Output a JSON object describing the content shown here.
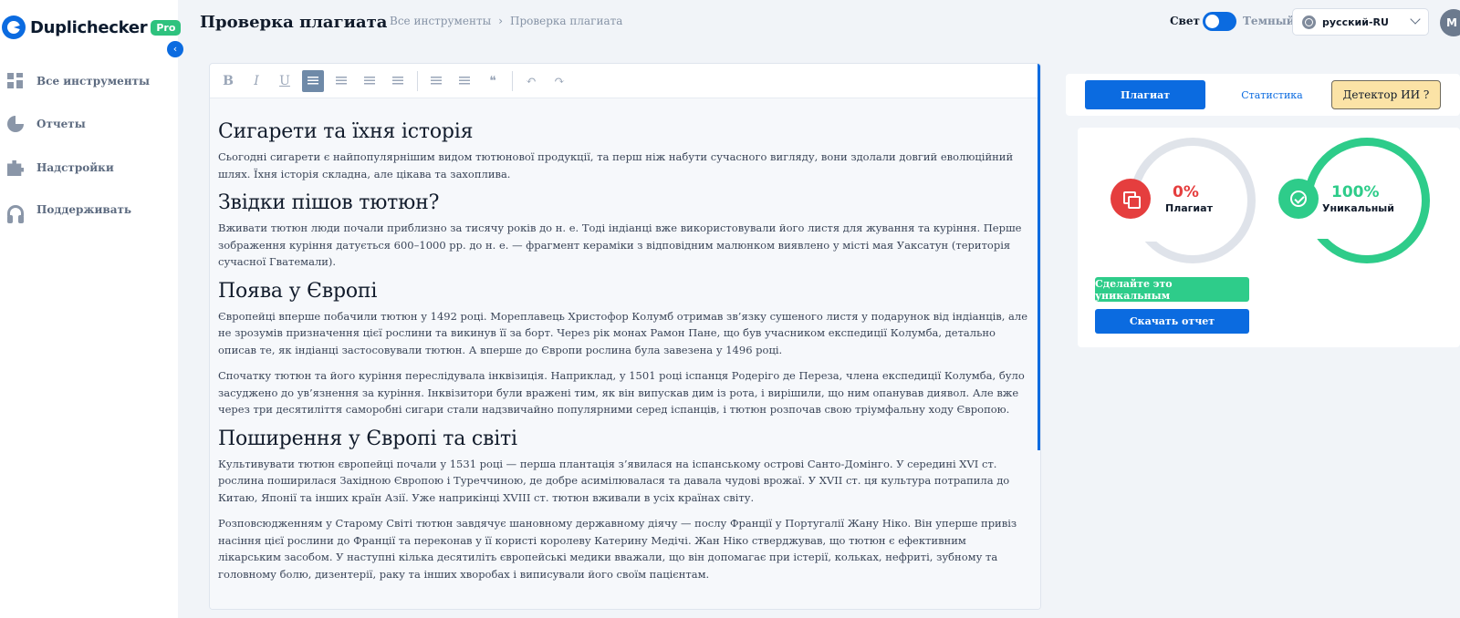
{
  "sidebar": {
    "brand": "Duplichecker",
    "badge": "Pro",
    "collapse_glyph": "‹",
    "items": [
      {
        "label": "Все инструменты",
        "icon": "grid-icon"
      },
      {
        "label": "Отчеты",
        "icon": "pie-chart-icon"
      },
      {
        "label": "Надстройки",
        "icon": "puzzle-icon"
      },
      {
        "label": "Поддерживать",
        "icon": "headset-icon"
      }
    ]
  },
  "header": {
    "title": "Проверка плагиата",
    "breadcrumb": [
      "Все инструменты",
      "Проверка плагиата"
    ],
    "breadcrumb_sep": "›",
    "theme_light": "Свет",
    "theme_dark": "Темный",
    "language": "русский-RU",
    "avatar_initial": "M"
  },
  "toolbar": {
    "bold": "B",
    "italic": "I",
    "underline": "U",
    "quote": "❝",
    "undo": "↶",
    "redo": "↷"
  },
  "editor": {
    "blocks": [
      {
        "type": "h",
        "text": "Сигарети та їхня історія"
      },
      {
        "type": "p",
        "text": "Сьогодні сигарети є найпопулярнішим видом тютюнової продукції, та перш ніж набути сучасного вигляду, вони здолали довгий еволюційний шлях. Їхня історія складна, але цікава та захоплива."
      },
      {
        "type": "h",
        "text": "Звідки пішов тютюн?"
      },
      {
        "type": "p",
        "text": "Вживати тютюн люди почали приблизно за тисячу років до н. е. Тоді індіанці вже використовували його листя для жування та куріння. Перше зображення куріння датується 600–1000 рр. до н. е. — фрагмент кераміки з відповідним малюнком виявлено у місті мая Уаксатун (територія сучасної Гватемали)."
      },
      {
        "type": "h",
        "text": "Поява у Європі"
      },
      {
        "type": "p",
        "text": "Європейці вперше побачили тютюн у 1492 році. Мореплавець Христофор Колумб отримав зв’язку сушеного листя у подарунок від індіанців, але не зрозумів призначення цієї рослини та викинув її за борт. Через рік монах Рамон Пане, що був учасником експедиції Колумба, детально описав те, як індіанці застосовували тютюн. А вперше до Європи рослина була завезена у 1496 році."
      },
      {
        "type": "p",
        "text": "Спочатку тютюн та його куріння переслідувала інквізиція. Наприклад, у 1501 році іспанця Родеріго де Переза, члена експедиції Колумба, було засуджено до ув’язнення за куріння. Інквізитори були вражені тим, як він випускав дим із рота, і вирішили, що ним опанував диявол. Але вже через три десятиліття саморобні сигари стали надзвичайно популярними серед іспанців, і тютюн розпочав свою тріумфальну ходу Європою."
      },
      {
        "type": "h",
        "text": "Поширення у Європі та світі"
      },
      {
        "type": "p",
        "text": "Культивувати тютюн європейці почали у 1531 році — перша плантація з’явилася на іспанському острові Санто-Домінго. У середині XVI ст. рослина поширилася Західною Європою і Туреччиною, де добре асимілювалася та давала чудові врожаї. У XVII ст. ця культура потрапила до Китаю, Японії та інших країн Азії. Уже наприкінці XVIII ст. тютюн вживали в усіх країнах світу."
      },
      {
        "type": "p",
        "text": "Розповсюдженням у Старому Світі тютюн завдячує шановному державному діячу — послу Франції у Португалії Жану Ніко. Він уперше привіз насіння цієї рослини до Франції та переконав у її користі королеву Катерину Медічі. Жан Ніко стверджував, що тютюн є ефективним лікарським засобом. У наступні кілька десятиліть європейські медики вважали, що він допомагає при істерії, кольках, нефриті, зубному та головному болю, дизентерії, раку та інших хворобах і виписували його своїм пацієнтам."
      }
    ]
  },
  "results": {
    "tabs": {
      "plagiarism": "Плагиат",
      "statistics": "Статистика",
      "ai_detector": "Детектор ИИ ?"
    },
    "plagiarism_percent": "0%",
    "plagiarism_label": "Плагиат",
    "unique_percent": "100%",
    "unique_label": "Уникальный",
    "make_unique_button": "Сделайте это уникальным",
    "download_button": "Скачать отчет"
  },
  "colors": {
    "accent": "#0b6be0",
    "success": "#2ecc8a",
    "danger": "#e53e3e",
    "ai_tab": "#fbe3a6"
  }
}
